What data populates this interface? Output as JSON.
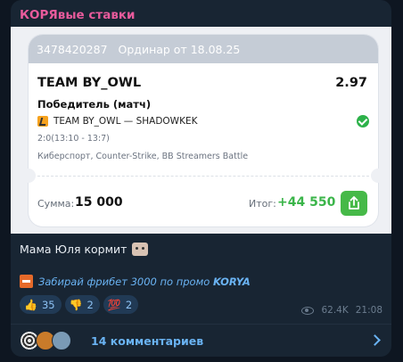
{
  "channel": {
    "name": "КОРЯвые ставки"
  },
  "ticket": {
    "id": "3478420287",
    "header_text": "Ординар от 18.08.25",
    "team": "TEAM BY_OWL",
    "odds": "2.97",
    "market": "Победитель (матч)",
    "match": "TEAM BY_OWL — SHADOWKEK",
    "score": "2:0(13:10 - 13:7)",
    "category": "Киберспорт, Counter-Strike, BB Streamers Battle",
    "sum_label": "Сумма:",
    "sum_value": "15 000",
    "total_label": "Итог:",
    "total_value": "+44 550",
    "accent_green": "#3bb54a",
    "icons": {
      "game": "counter-strike-icon",
      "status": "check-circle-icon",
      "share": "share-icon"
    }
  },
  "message": {
    "caption": "Мама Юля кормит",
    "caption_emoji": "cat-emoji",
    "promo_text": "Забирай фрибет 3000 по промо",
    "promo_code": "KORYA"
  },
  "reactions": [
    {
      "emoji": "👍",
      "count": "35"
    },
    {
      "emoji": "👎",
      "count": "2"
    },
    {
      "emoji": "💯",
      "count": "2"
    }
  ],
  "meta": {
    "views": "62.4K",
    "time": "21:08"
  },
  "comments": {
    "label": "14 комментариев"
  },
  "colors": {
    "background": "#0e1621",
    "bubble": "#182533",
    "accent_blue": "#6ab3f3",
    "channel_name": "#e85b9c"
  }
}
